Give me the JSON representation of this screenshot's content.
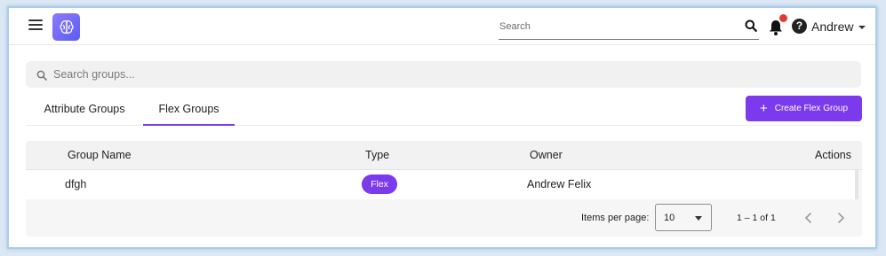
{
  "header": {
    "search_placeholder": "Search",
    "user_name": "Andrew"
  },
  "groups_search": {
    "placeholder": "Search groups..."
  },
  "tabs": [
    {
      "label": "Attribute Groups",
      "active": false
    },
    {
      "label": "Flex Groups",
      "active": true
    }
  ],
  "create_button": {
    "label": "Create Flex Group"
  },
  "table": {
    "columns": {
      "name": "Group Name",
      "type": "Type",
      "owner": "Owner",
      "actions": "Actions"
    },
    "rows": [
      {
        "name": "dfgh",
        "type": "Flex",
        "owner": "Andrew Felix"
      }
    ]
  },
  "paginator": {
    "items_per_page_label": "Items per page:",
    "items_per_page_value": "10",
    "range": "1 – 1 of 1"
  },
  "colors": {
    "accent": "#7c3aed",
    "notification_dot": "#e53935",
    "logo_gradient_start": "#8b7bff",
    "logo_gradient_end": "#5d5bf0"
  },
  "icons": [
    "menu-icon",
    "brain-logo-icon",
    "search-icon",
    "bell-icon",
    "help-icon",
    "caret-down-icon",
    "plus-icon",
    "chevron-left-icon",
    "chevron-right-icon"
  ]
}
